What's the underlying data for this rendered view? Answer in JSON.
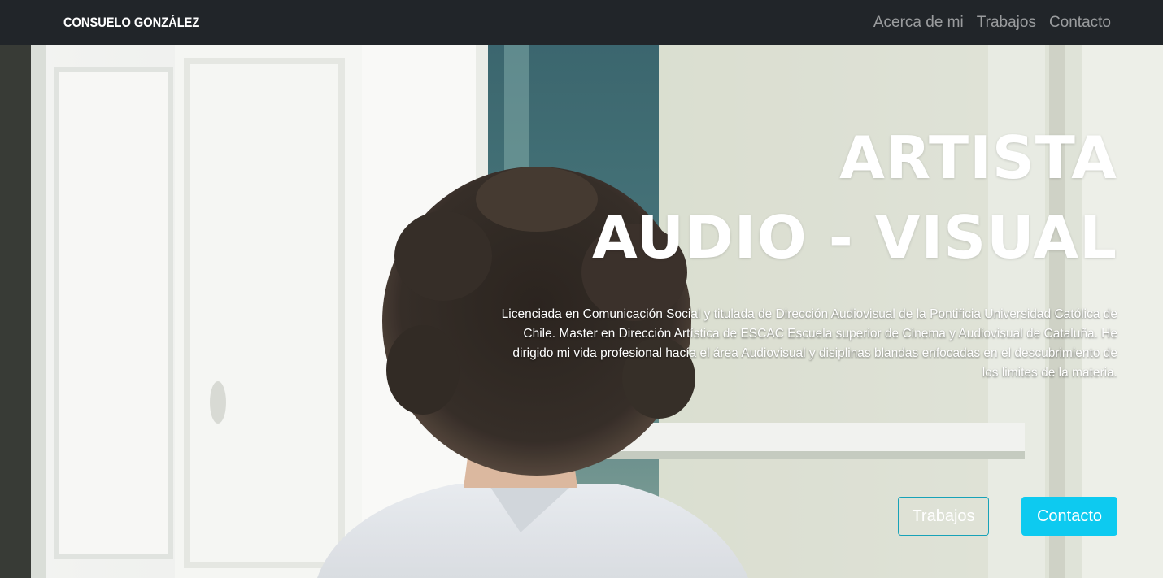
{
  "navbar": {
    "brand": "CONSUELO GONZÁLEZ",
    "links": [
      "Acerca de mi",
      "Trabajos",
      "Contacto"
    ]
  },
  "hero": {
    "headline_line1": "ARTISTA",
    "headline_line2": "AUDIO - VISUAL",
    "description": "Licenciada en Comunicación Social y titulada de Dirección Audiovisual de la Pontificia Universidad Católica de Chile. Master en Dirección Artística de ESCAC Escuela superior de Cinema y Audiovisual de Cataluña. He dirigido mi vida profesional hacía el área Audiovisual y disiplinas blandas enfocadas en el descubrimiento de los limites de la materia.",
    "buttons": {
      "trabajos": "Trabajos",
      "contacto": "Contacto"
    }
  },
  "colors": {
    "navbar_bg": "#212529",
    "accent": "#0dcaf0",
    "outline": "#17a2b8"
  }
}
